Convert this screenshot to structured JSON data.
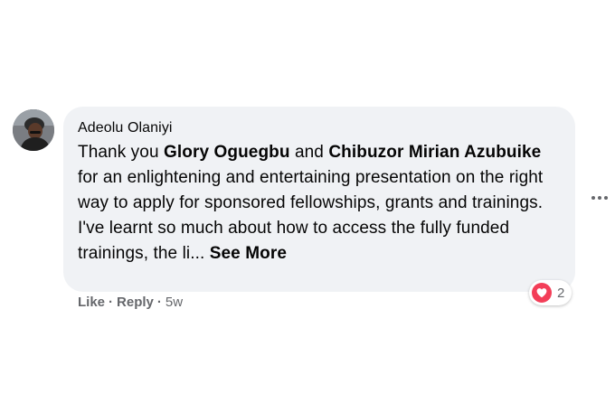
{
  "comment": {
    "author": "Adeolu Olaniyi",
    "text_part1": "Thank you ",
    "mention1": "Glory Oguegbu",
    "text_part2": " and ",
    "mention2": "Chibuzor Mirian Azubuike",
    "text_part3": " for an enlightening and entertaining presentation on the right way to apply for sponsored fellowships, grants and trainings.",
    "text_part4": "I've learnt so much about how to access the fully funded trainings, the li... ",
    "see_more": "See More"
  },
  "reactions": {
    "icon": "heart-icon",
    "count": "2",
    "color": "#f33e58"
  },
  "actions": {
    "like": "Like",
    "reply": "Reply",
    "separator": "·",
    "time": "5w"
  },
  "more_options_icon": "more-horizontal-icon"
}
